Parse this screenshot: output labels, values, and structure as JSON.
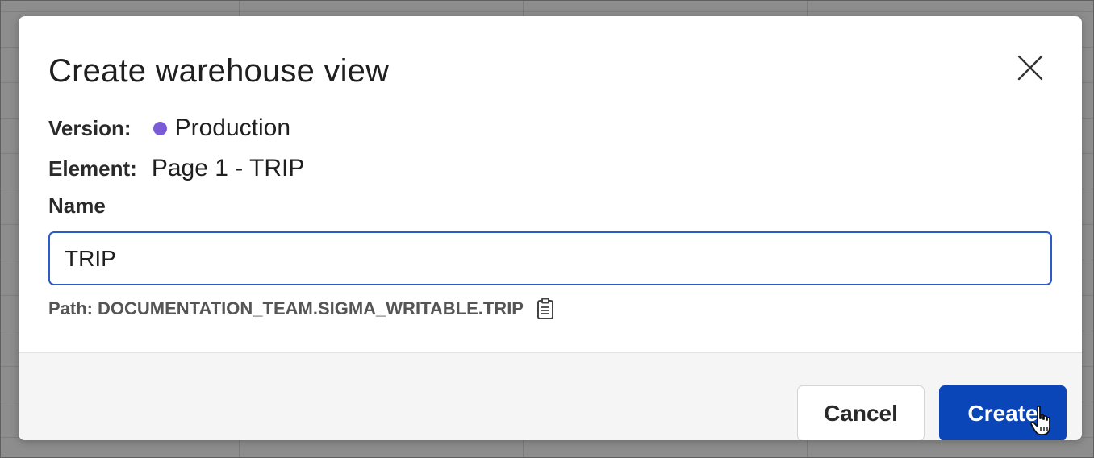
{
  "dialog": {
    "title": "Create warehouse view",
    "close_icon": "close-icon",
    "version": {
      "label": "Version:",
      "value": "Production",
      "dot_color": "#7b5bd6"
    },
    "element": {
      "label": "Element:",
      "value": "Page 1 - TRIP"
    },
    "name_field": {
      "label": "Name",
      "value": "TRIP"
    },
    "path": {
      "label": "Path:",
      "value": "DOCUMENTATION_TEAM.SIGMA_WRITABLE.TRIP",
      "copy_icon": "clipboard-icon"
    },
    "footer": {
      "cancel_label": "Cancel",
      "create_label": "Create"
    }
  },
  "colors": {
    "accent": "#0a46b8",
    "input_focus_border": "#2a5bc7",
    "version_dot": "#7b5bd6"
  }
}
